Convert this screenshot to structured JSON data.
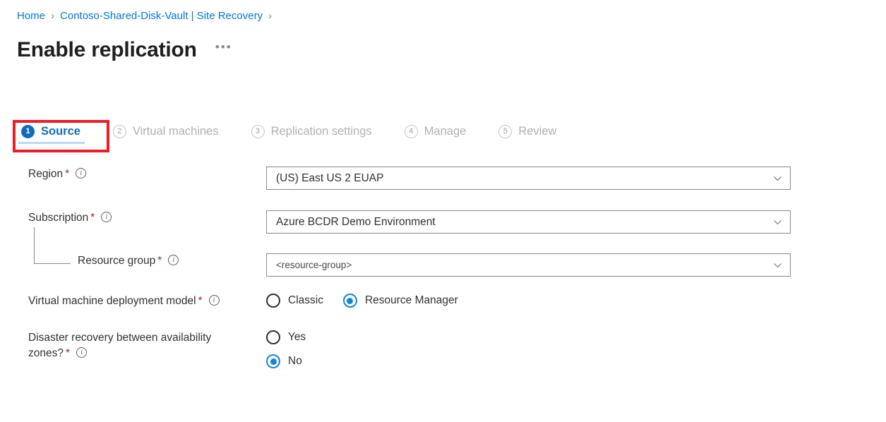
{
  "breadcrumb": {
    "items": [
      {
        "label": "Home"
      },
      {
        "label": "Contoso-Shared-Disk-Vault | Site Recovery"
      }
    ],
    "separator": "›"
  },
  "header": {
    "title": "Enable replication",
    "more_label": "•••",
    "more_icon": "ellipsis-icon"
  },
  "tabs": [
    {
      "num": "1",
      "label": "Source",
      "state": "active"
    },
    {
      "num": "2",
      "label": "Virtual machines",
      "state": "inactive"
    },
    {
      "num": "3",
      "label": "Replication settings",
      "state": "inactive"
    },
    {
      "num": "4",
      "label": "Manage",
      "state": "inactive"
    },
    {
      "num": "5",
      "label": "Review",
      "state": "inactive"
    }
  ],
  "form": {
    "region": {
      "label": "Region",
      "required": "*",
      "info_icon": "info-icon",
      "value": "(US) East US 2 EUAP",
      "chevron_icon": "chevron-down-icon"
    },
    "subscription": {
      "label": "Subscription",
      "required": "*",
      "info_icon": "info-icon",
      "value": "Azure BCDR Demo Environment",
      "chevron_icon": "chevron-down-icon"
    },
    "resource_group": {
      "label": "Resource group",
      "required": "*",
      "info_icon": "info-icon",
      "value": "<resource-group>",
      "chevron_icon": "chevron-down-icon"
    },
    "deployment_model": {
      "label": "Virtual machine deployment model",
      "required": "*",
      "info_icon": "info-icon",
      "options": [
        {
          "label": "Classic",
          "checked": false
        },
        {
          "label": "Resource Manager",
          "checked": true
        }
      ]
    },
    "availability_zones": {
      "label_line1": "Disaster recovery between availability",
      "label_line2": "zones?",
      "required": "*",
      "info_icon": "info-icon",
      "options": [
        {
          "label": "Yes",
          "checked": false
        },
        {
          "label": "No",
          "checked": true
        }
      ]
    }
  },
  "annotation": {
    "type": "highlight-rectangle",
    "color": "#ee1c25",
    "target": "tab-source"
  },
  "colors": {
    "accent": "#0078d4",
    "tab_active": "#0f6cbd",
    "radio_checked": "#0f85dd",
    "required_asterisk": "#a4262c",
    "annotation_red": "#ee1c25"
  }
}
